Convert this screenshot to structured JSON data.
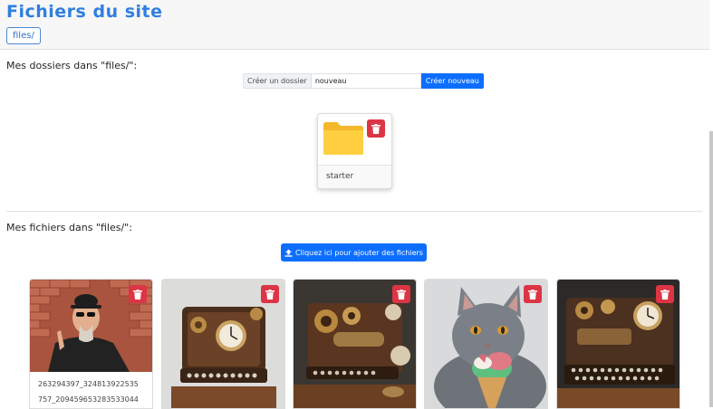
{
  "header": {
    "title": "Fichiers du site",
    "breadcrumb": "files/"
  },
  "folders": {
    "heading": "Mes dossiers dans \"files/\":",
    "create_label": "Créer un dossier",
    "create_value": "nouveau",
    "create_button": "Créer nouveau",
    "items": [
      {
        "name": "starter",
        "icon": "folder-icon"
      }
    ]
  },
  "files": {
    "heading": "Mes fichiers dans \"files/\":",
    "upload_button": "Cliquez ici pour ajouter des fichiers",
    "items": [
      {
        "name_line1": "263294397_324813922535",
        "name_line2": "757_209459653283533044",
        "image": "man-photo"
      },
      {
        "image": "steampunk-machine-1"
      },
      {
        "image": "steampunk-machine-2"
      },
      {
        "image": "cat-ice-cream"
      },
      {
        "image": "steampunk-machine-3"
      }
    ]
  },
  "colors": {
    "primary": "#0d6efd",
    "danger": "#dc3545",
    "title": "#2f7fe0",
    "folder": "#ffc83a"
  }
}
